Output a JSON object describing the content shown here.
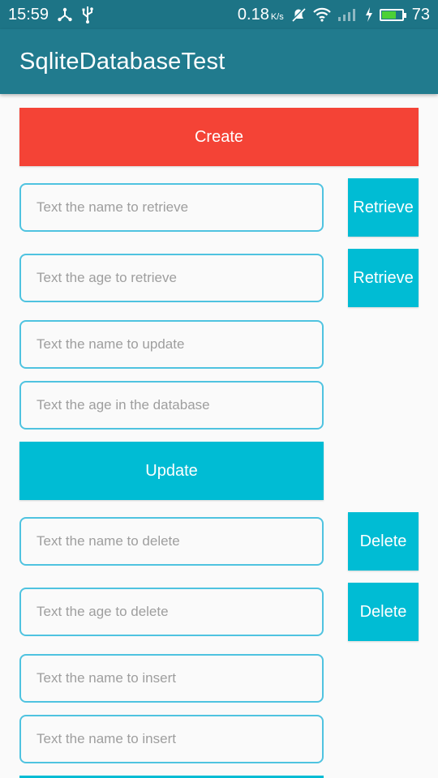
{
  "status_bar": {
    "time": "15:59",
    "speed_value": "0.18",
    "speed_unit": "K/s",
    "battery_level": "73",
    "icons": [
      "usb-share-icon",
      "usb-icon",
      "notifications-off-icon",
      "wifi-icon",
      "signal-icon",
      "charging-bolt-icon",
      "battery-icon"
    ]
  },
  "app_bar": {
    "title": "SqliteDatabaseTest"
  },
  "buttons": {
    "create": "Create",
    "retrieve_name": "Retrieve",
    "retrieve_age": "Retrieve",
    "update": "Update",
    "delete_name": "Delete",
    "delete_age": "Delete"
  },
  "fields": {
    "retrieve_name": {
      "placeholder": "Text the name to retrieve",
      "value": ""
    },
    "retrieve_age": {
      "placeholder": "Text the age to retrieve",
      "value": ""
    },
    "update_name": {
      "placeholder": "Text the name to update",
      "value": ""
    },
    "update_age": {
      "placeholder": "Text the age in the database",
      "value": ""
    },
    "delete_name": {
      "placeholder": "Text the name to delete",
      "value": ""
    },
    "delete_age": {
      "placeholder": "Text the age to delete",
      "value": ""
    },
    "insert_name": {
      "placeholder": "Text the name to insert",
      "value": ""
    },
    "insert_name_2": {
      "placeholder": "Text the name to insert",
      "value": ""
    }
  },
  "colors": {
    "status_bar": "#1d7486",
    "app_bar": "#217b8e",
    "create_button": "#f44336",
    "action_button": "#00bcd4",
    "field_border": "#4fc3e0",
    "battery_fill": "#4cd137"
  }
}
